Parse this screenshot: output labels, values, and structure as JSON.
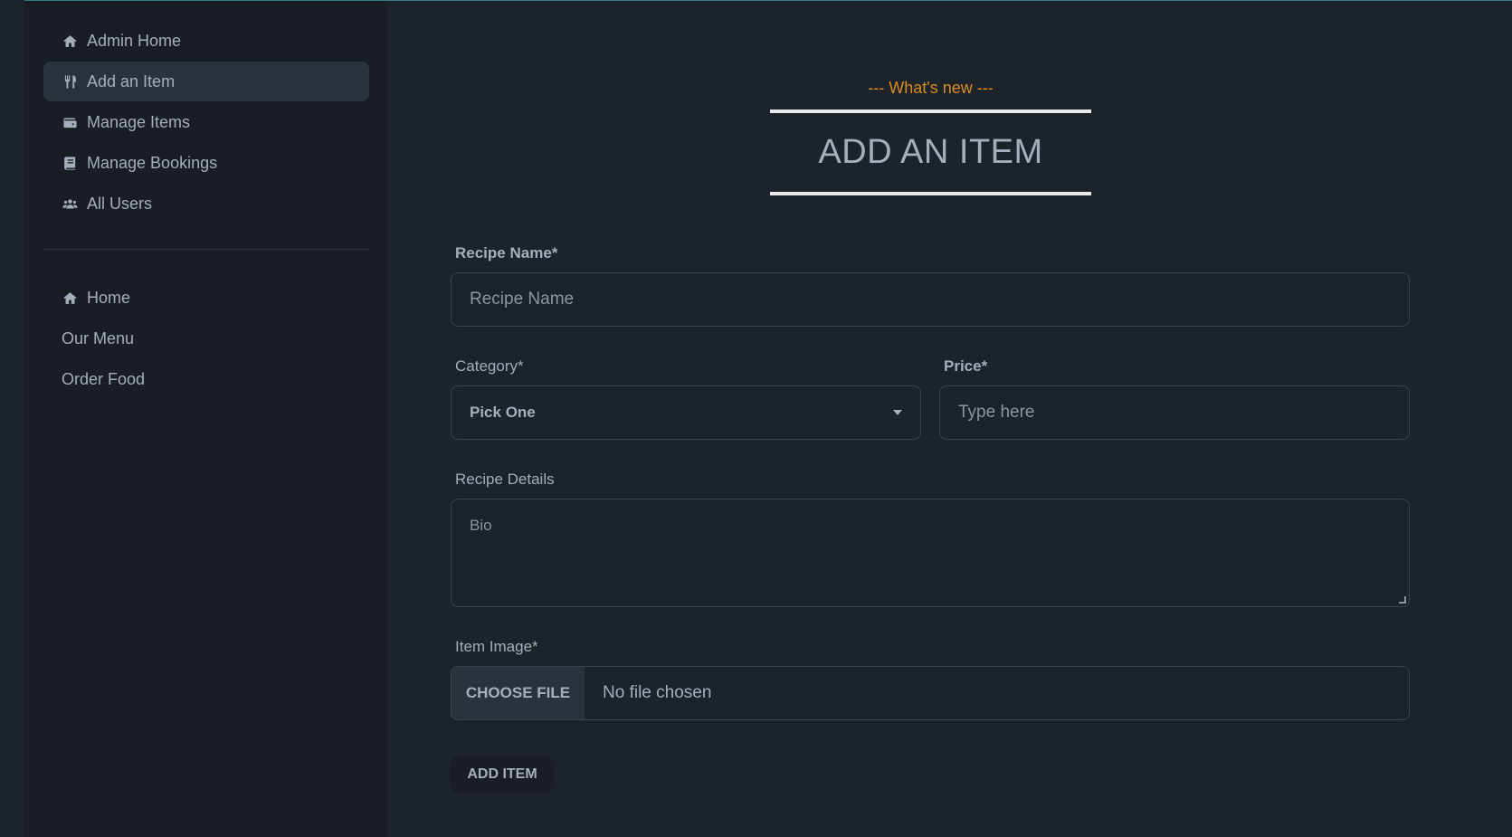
{
  "sidebar": {
    "main_items": [
      {
        "label": "Admin Home",
        "icon": "home-icon"
      },
      {
        "label": "Add an Item",
        "icon": "utensils-icon",
        "active": true
      },
      {
        "label": "Manage Items",
        "icon": "wallet-icon"
      },
      {
        "label": "Manage Bookings",
        "icon": "book-icon"
      },
      {
        "label": "All Users",
        "icon": "users-icon"
      }
    ],
    "secondary_items": [
      {
        "label": "Home",
        "icon": "home-icon"
      },
      {
        "label": "Our Menu"
      },
      {
        "label": "Order Food"
      }
    ]
  },
  "heading": {
    "subtitle": "--- What's new ---",
    "title": "ADD AN ITEM"
  },
  "form": {
    "recipe_name": {
      "label": "Recipe Name*",
      "placeholder": "Recipe Name"
    },
    "category": {
      "label": "Category*",
      "selected": "Pick One"
    },
    "price": {
      "label": "Price*",
      "placeholder": "Type here"
    },
    "details": {
      "label": "Recipe Details",
      "placeholder": "Bio"
    },
    "image": {
      "label": "Item Image*",
      "button": "CHOOSE FILE",
      "status": "No file chosen"
    },
    "submit_label": "ADD ITEM"
  },
  "colors": {
    "accent": "#d98c1b",
    "background": "#1d232a",
    "sidebar": "#191e24"
  }
}
